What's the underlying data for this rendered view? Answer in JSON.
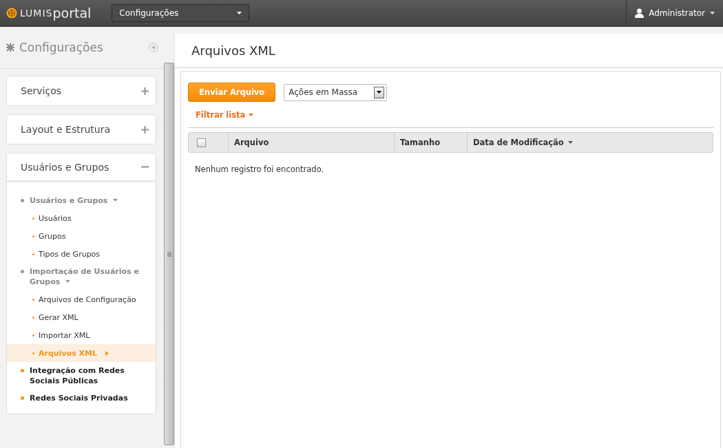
{
  "topbar": {
    "logo": {
      "prefix": "LUMIS",
      "suffix": "portal"
    },
    "context_select": {
      "value": "Configurações"
    },
    "user": "Administrator"
  },
  "sidebar": {
    "title": "Configurações",
    "sections": [
      {
        "title": "Serviços",
        "expanded": false
      },
      {
        "title": "Layout e Estrutura",
        "expanded": false
      },
      {
        "title": "Usuários e Grupos",
        "expanded": true,
        "tree": [
          {
            "label": "Usuários e Grupos",
            "expanded": true,
            "children": [
              {
                "label": "Usuários",
                "selected": false
              },
              {
                "label": "Grupos",
                "selected": false
              },
              {
                "label": "Tipos de Grupos",
                "selected": false
              }
            ]
          },
          {
            "label": "Importação de Usuários e Grupos",
            "expanded": true,
            "children": [
              {
                "label": "Arquivos de Configuração",
                "selected": false
              },
              {
                "label": "Gerar XML",
                "selected": false
              },
              {
                "label": "Importar XML",
                "selected": false
              },
              {
                "label": "Arquivos XML",
                "selected": true
              }
            ]
          },
          {
            "label": "Integração com Redes Sociais Públicas"
          },
          {
            "label": "Redes Sociais Privadas"
          }
        ]
      }
    ]
  },
  "main": {
    "title": "Arquivos XML",
    "upload_button": "Enviar Arquivo",
    "bulk_actions": {
      "value": "Ações em Massa"
    },
    "filter": "Filtrar lista",
    "table": {
      "select_all_checked": false,
      "columns": [
        {
          "label": "Arquivo",
          "sorted": false
        },
        {
          "label": "Tamanho",
          "sorted": false
        },
        {
          "label": "Data de Modificação",
          "sorted": true
        }
      ],
      "empty_message": "Nenhum registro foi encontrado."
    }
  }
}
